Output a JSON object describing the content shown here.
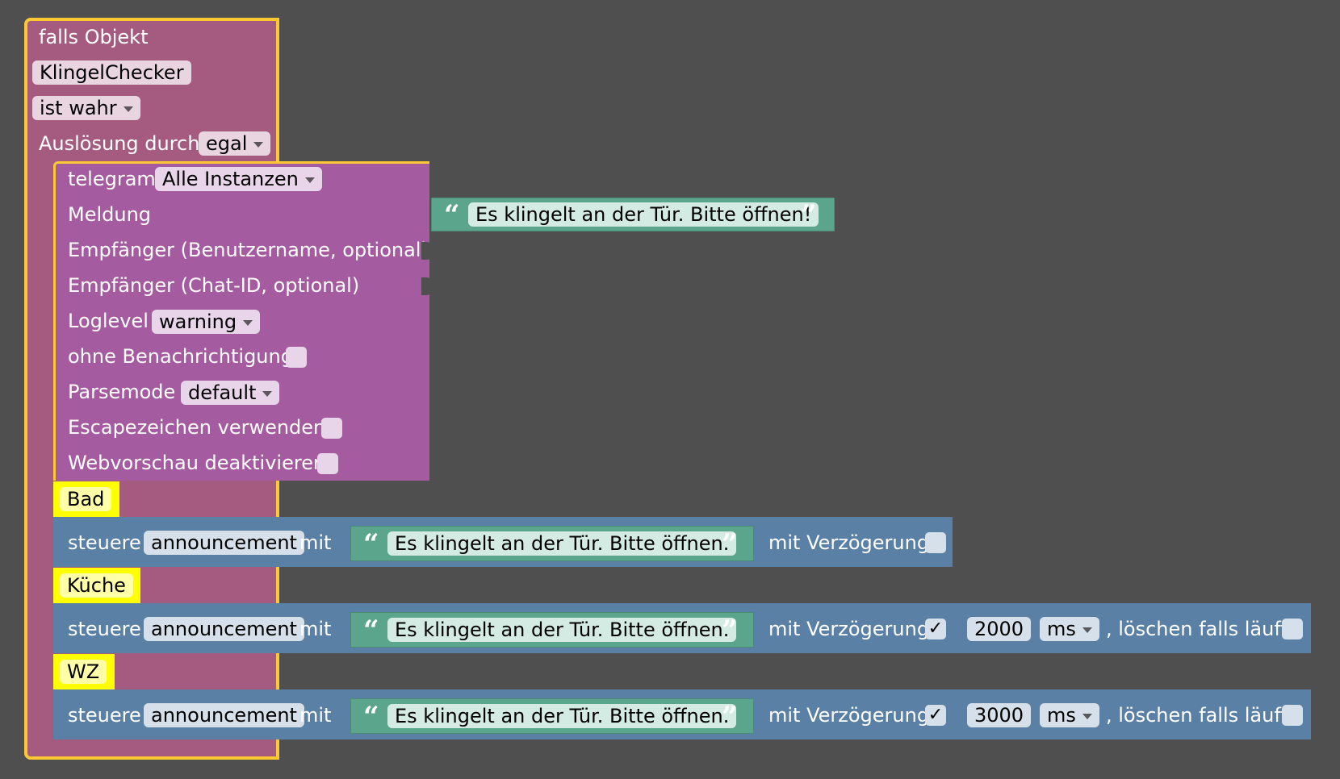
{
  "trigger": {
    "label": "falls Objekt",
    "object": "KlingelChecker",
    "condition": "ist wahr",
    "ausloesung_label": "Auslösung durch",
    "ausloesung_value": "egal"
  },
  "telegram": {
    "label": "telegram",
    "instance": "Alle Instanzen",
    "meldung_label": "Meldung",
    "meldung_text": "Es klingelt an der Tür. Bitte öffnen!",
    "empf_user_label": "Empfänger (Benutzername, optional)",
    "empf_chat_label": "Empfänger (Chat-ID, optional)",
    "loglevel_label": "Loglevel",
    "loglevel_value": "warning",
    "silent_label": "ohne Benachrichtigung",
    "parsemode_label": "Parsemode",
    "parsemode_value": "default",
    "escape_label": "Escapezeichen verwenden",
    "webpreview_label": "Webvorschau deaktivieren"
  },
  "controls": [
    {
      "comment": "Bad",
      "steuere_label": "steuere",
      "target": "announcement",
      "mit_label": "mit",
      "text": "Es klingelt an der Tür. Bitte öffnen.",
      "delay_label": "mit Verzögerung",
      "delay_checked": false
    },
    {
      "comment": "Küche",
      "steuere_label": "steuere",
      "target": "announcement",
      "mit_label": "mit",
      "text": "Es klingelt an der Tür. Bitte öffnen.",
      "delay_label": "mit Verzögerung",
      "delay_checked": true,
      "delay_mark": "✓",
      "delay_value": "2000",
      "delay_unit": "ms",
      "clear_label": ", löschen falls läuft"
    },
    {
      "comment": "WZ",
      "steuere_label": "steuere",
      "target": "announcement",
      "mit_label": "mit",
      "text": "Es klingelt an der Tür. Bitte öffnen.",
      "delay_label": "mit Verzögerung",
      "delay_checked": true,
      "delay_mark": "✓",
      "delay_value": "3000",
      "delay_unit": "ms",
      "clear_label": ", löschen falls läuft"
    }
  ],
  "colors": {
    "workspace": "#4f4f4f",
    "trigger_block": "#a55b80",
    "selected_outline": "#fcc933",
    "telegram_block": "#a55ba0",
    "text_block": "#5ba58c",
    "control_block": "#5b80a5",
    "comment_block": "#ffff00",
    "field_bg": "#ffffff"
  }
}
